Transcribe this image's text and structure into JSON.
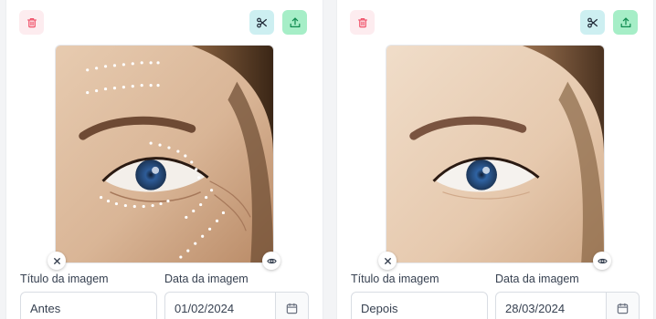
{
  "cards": [
    {
      "variant": "before",
      "title_label": "Título da imagem",
      "date_label": "Data da imagem",
      "title_value": "Antes",
      "date_value": "01/02/2024"
    },
    {
      "variant": "after",
      "title_label": "Título da imagem",
      "date_label": "Data da imagem",
      "title_value": "Depois",
      "date_value": "28/03/2024"
    }
  ],
  "icons": {
    "delete": "trash-icon",
    "crop": "scissors-icon",
    "upload": "upload-icon",
    "remove": "close-icon",
    "preview": "eye-icon",
    "calendar": "calendar-icon"
  },
  "colors": {
    "delete_bg": "#fdecef",
    "delete_fg": "#f0536b",
    "crop_bg": "#cdeff1",
    "upload_bg": "#a6eec7",
    "upload_fg": "#0f8a4f"
  }
}
